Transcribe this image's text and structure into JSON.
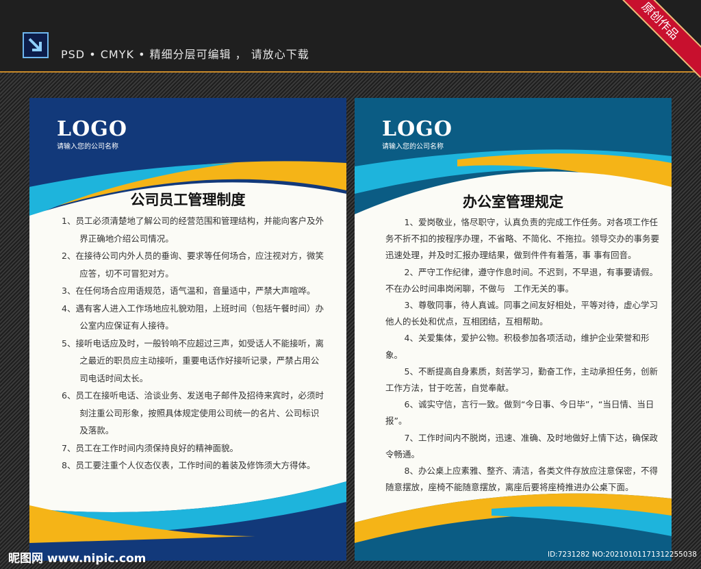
{
  "header": {
    "text": "PSD • CMYK • 精细分层可编辑 ， 请放心下载",
    "ribbon": "原创作品"
  },
  "colors": {
    "left_bg": "#12397a",
    "right_bg": "#0b5c84",
    "cyan": "#1eb4dc",
    "yellow": "#f5b417"
  },
  "left": {
    "logo": "LOGO",
    "company": "请输入您的公司名称",
    "title": "公司员工管理制度",
    "items": [
      "1、员工必须清楚地了解公司的经营范围和管理结构，并能向客户及外界正确地介绍公司情况。",
      "2、在接待公司内外人员的垂询、要求等任何场合，应注视对方，微笑应答，切不可冒犯对方。",
      "3、在任何场合应用语规范，语气温和，音量适中，严禁大声喧哗。",
      "4、遇有客人进入工作场地应礼貌劝阻，上班时间（包括午餐时间）办公室内应保证有人接待。",
      "5、接听电话应及时，一般铃响不应超过三声，如受话人不能接听，离之最近的职员应主动接听，重要电话作好接听记录，严禁占用公司电话时间太长。",
      "6、员工在接听电话、洽谈业务、发送电子邮件及招待来宾时，必须时刻注重公司形象，按照具体规定使用公司统一的名片、公司标识及落款。",
      "7、员工在工作时间内须保持良好的精神面貌。",
      "8、员工要注重个人仪态仪表，工作时间的着装及修饰须大方得体。"
    ]
  },
  "right": {
    "logo": "LOGO",
    "company": "请输入您的公司名称",
    "title": "办公室管理规定",
    "items": [
      "1、爱岗敬业，恪尽职守，认真负责的完成工作任务。对各项工作任务不折不扣的按程序办理，不省略、不简化、不拖拉。领导交办的事务要迅速处理，并及时汇报办理结果，做到件件有着落，事 事有回音。",
      "2、严守工作纪律，遵守作息时间。不迟到，不早退，有事要请假。不在办公时间串岗闲聊，不做与　工作无关的事。",
      "3、尊敬同事，待人真诚。同事之间友好相处，平等对待，虚心学习他人的长处和优点，互相团结，互相帮助。",
      "4、关爱集体，爱护公物。积极参加各项活动，维护企业荣誉和形象。",
      "5、不断提高自身素质，刻苦学习，勤奋工作，主动承担任务，创新工作方法，甘于吃苦，自觉奉献。",
      "6、诚实守信，言行一致。做到“今日事、今日毕”，“当日情、当日报”。",
      "7、工作时间内不脱岗，迅速、准确、及时地做好上情下达，确保政令畅通。",
      "8、办公桌上应素雅、整齐、清洁，各类文件存放应注意保密，不得随意摆放，座椅不能随意摆放，离座后要将座椅推进办公桌下面。"
    ]
  },
  "watermark": {
    "site": "昵图网 www.nipic.com",
    "id": "ID:7231282 NO:20210101171312255038"
  }
}
